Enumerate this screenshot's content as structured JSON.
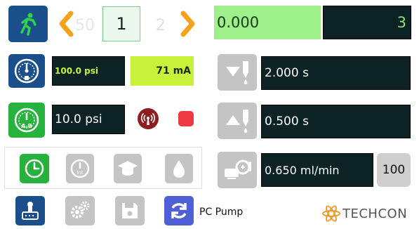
{
  "header": {
    "prev_step": "50",
    "current_step": "1",
    "next_step": "2",
    "counter_value": "0.000",
    "counter_total": "3"
  },
  "pressure": {
    "psi_value": "100.0 psi",
    "ma_value": "71 mA",
    "ab_psi_value": "10.0 psi"
  },
  "timers": {
    "time_1": "2.000 s",
    "time_2": "0.500 s"
  },
  "pump": {
    "flow_rate": "0.650 ml/min",
    "percent": "100",
    "mode_label": "PC Pump"
  },
  "brand": {
    "logo_text": "TECHCON"
  },
  "mode_tabs": [
    "timer-tab",
    "interval-tab",
    "learn-tab",
    "drop-tab"
  ],
  "colors": {
    "accent_green": "#27b23e",
    "field_green": "#9ef08a",
    "dark_field": "#0c2224",
    "brand_blue": "#1a4f8c",
    "arrow_orange": "#f4a21c",
    "status_red": "#ee3a42",
    "logo_orange": "#e8a13a"
  }
}
